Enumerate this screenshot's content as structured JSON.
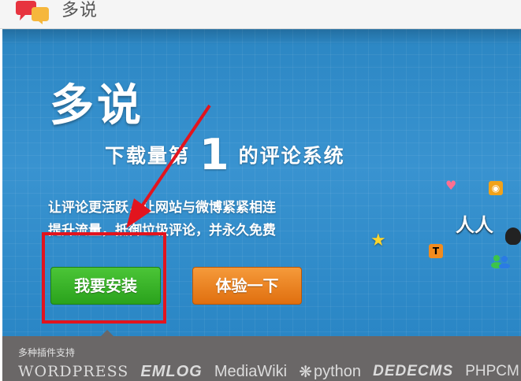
{
  "header": {
    "brand": "多说"
  },
  "hero": {
    "headline": "多说",
    "tagline": {
      "prefix": "下载量第",
      "number": "1",
      "suffix": "的评论系统"
    },
    "desc_line1": "让评论更活跃，让网站与微博紧紧相连",
    "desc_line2": "提升流量，抵御垃圾评论，并永久免费",
    "install_label": "我要安装",
    "try_label": "体验一下"
  },
  "icons": {
    "heart": "♥",
    "rss": "◉",
    "renren": "人人",
    "star": "★",
    "t_badge": "T",
    "names": [
      "heart-icon",
      "rss-icon",
      "renren-icon",
      "star-icon",
      "tencent-weibo-icon",
      "qq-icon",
      "msn-icon"
    ]
  },
  "plugins": {
    "label": "多种插件支持",
    "logos": [
      "WORDPRESS",
      "EMLOG",
      "MediaWiki",
      "python",
      "DEDECMS",
      "PHPCM"
    ]
  },
  "colors": {
    "hero_blue": "#2b86c3",
    "install_green": "#2aa21c",
    "try_orange": "#e06f0f",
    "highlight_red": "#e2141e",
    "strip_gray": "#6a6767"
  }
}
